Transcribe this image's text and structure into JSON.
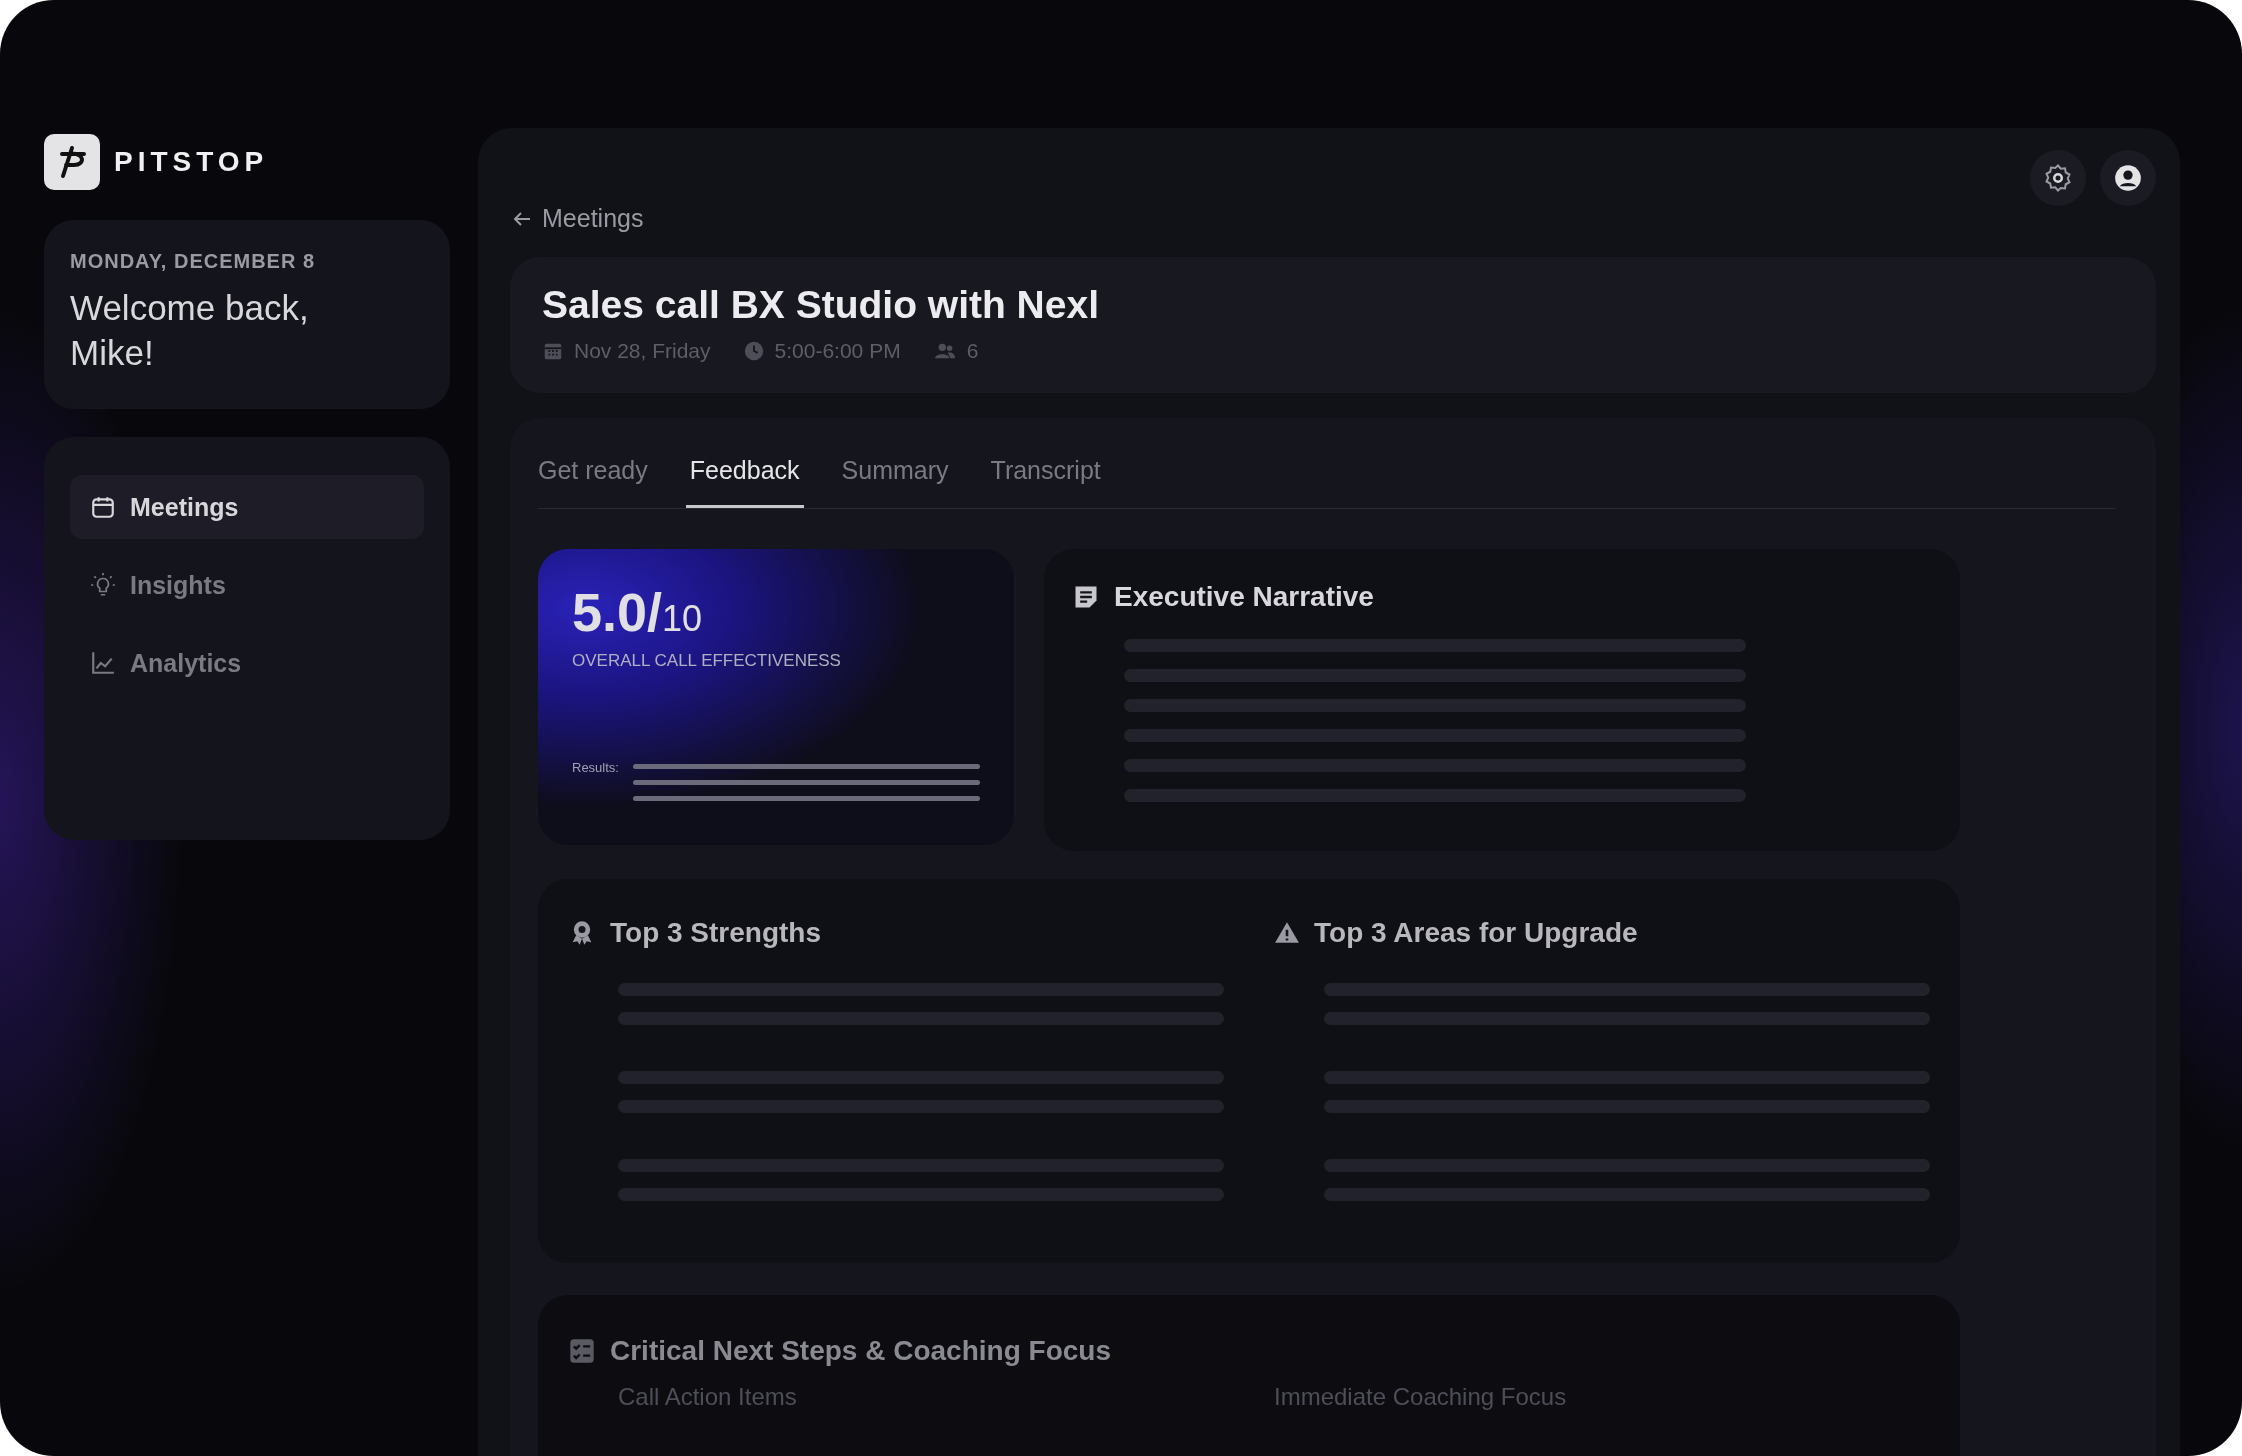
{
  "brand": {
    "name": "PITSTOP"
  },
  "greeting": {
    "date": "MONDAY, DECEMBER 8",
    "message": "Welcome back, Mike!"
  },
  "nav": [
    {
      "label": "Meetings",
      "kind": "calendar",
      "selected": true
    },
    {
      "label": "Insights",
      "kind": "bulb",
      "selected": false
    },
    {
      "label": "Analytics",
      "kind": "chart",
      "selected": false
    }
  ],
  "back_link": "Meetings",
  "meeting": {
    "title": "Sales call BX Studio with Nexl",
    "date": "Nov 28, Friday",
    "time": "5:00-6:00 PM",
    "attendees": "6"
  },
  "tabs": [
    {
      "label": "Get ready",
      "selected": false
    },
    {
      "label": "Feedback",
      "selected": true
    },
    {
      "label": "Summary",
      "selected": false
    },
    {
      "label": "Transcript",
      "selected": false
    }
  ],
  "score": {
    "value": "5.0/",
    "out_of": "10",
    "label": "OVERALL CALL EFFECTIVENESS",
    "results_label": "Results:"
  },
  "narrative": {
    "title": "Executive Narrative"
  },
  "strengths": {
    "title": "Top 3 Strengths"
  },
  "upgrades": {
    "title": "Top 3 Areas for Upgrade"
  },
  "next_steps": {
    "title": "Critical Next Steps & Coaching Focus",
    "columns": [
      "Call Action Items",
      "Immediate Coaching Focus"
    ]
  }
}
